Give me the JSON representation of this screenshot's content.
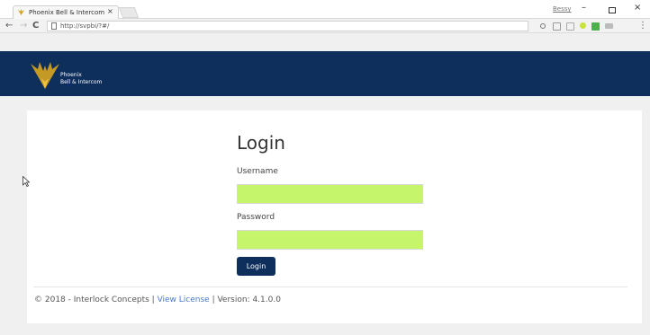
{
  "browser": {
    "tab_title": "Phoenix Bell & Intercom",
    "tab_close": "×",
    "profile": "Bessy",
    "url": "http://svpbi/?#/"
  },
  "header": {
    "logo_line1": "Phoenix",
    "logo_line2": "Bell & Intercom"
  },
  "login": {
    "title": "Login",
    "username_label": "Username",
    "username_value": "",
    "password_label": "Password",
    "password_value": "",
    "button_label": "Login"
  },
  "footer": {
    "copyright": "© 2018 - Interlock Concepts | ",
    "license_link": "View License",
    "version": " | Version: 4.1.0.0"
  },
  "colors": {
    "brand": "#0e2e5c",
    "autofill": "#c4f56a",
    "link": "#4a78c8"
  }
}
